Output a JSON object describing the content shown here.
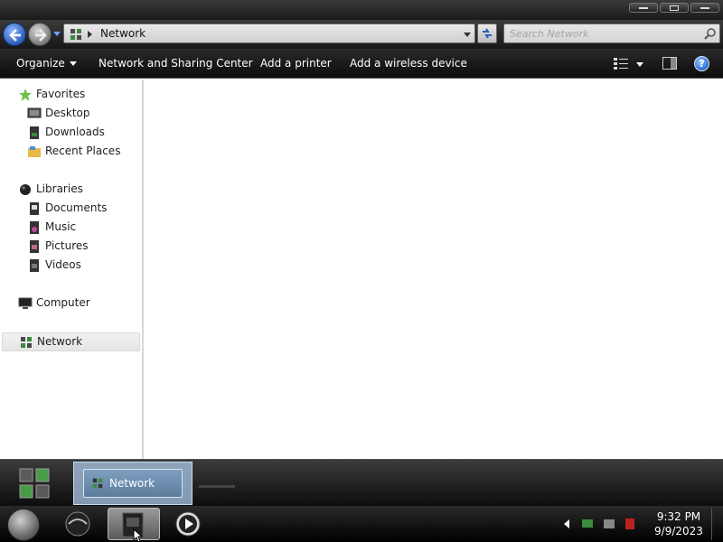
{
  "window": {
    "address": {
      "crumb": "Network"
    },
    "search": {
      "placeholder": "Search Network"
    },
    "toolbar": {
      "organize": "Organize",
      "network_sharing": "Network and Sharing Center",
      "add_printer": "Add a printer",
      "add_wireless": "Add a wireless device",
      "help": "?"
    },
    "nav": {
      "favorites": {
        "label": "Favorites",
        "items": [
          "Desktop",
          "Downloads",
          "Recent Places"
        ]
      },
      "libraries": {
        "label": "Libraries",
        "items": [
          "Documents",
          "Music",
          "Pictures",
          "Videos"
        ]
      },
      "computer": "Computer",
      "network": "Network",
      "selected": "Network"
    }
  },
  "taskbar": {
    "thumbnail_title": "Network",
    "clock": {
      "time": "9:32 PM",
      "date": "9/9/2023"
    }
  },
  "colors": {
    "accent": "#2a5db8",
    "toolbar_bg": "#1a1a1a",
    "selection": "#e5e5e5"
  },
  "icons": {
    "back": "back-arrow-icon",
    "forward": "forward-arrow-icon",
    "refresh": "refresh-icon",
    "search": "search-icon",
    "views": "change-view-icon",
    "preview": "preview-pane-icon",
    "help": "help-icon"
  }
}
